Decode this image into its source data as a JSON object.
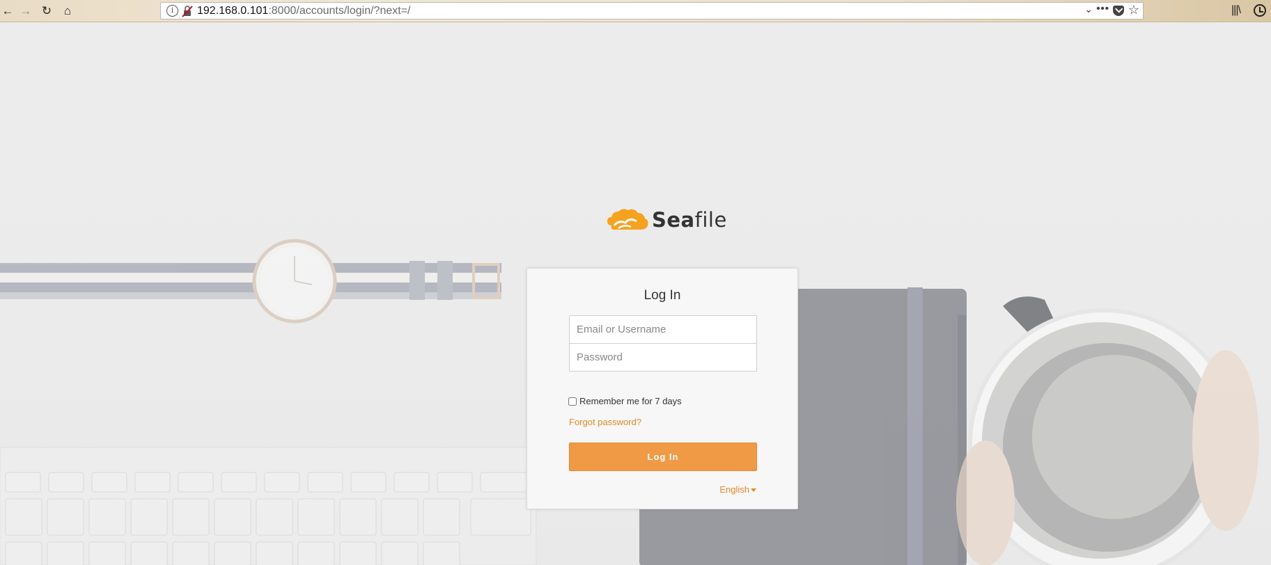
{
  "browser": {
    "url_host": "192.168.0.101",
    "url_rest": ":8000/accounts/login/?next=/"
  },
  "logo": {
    "text_bold": "Sea",
    "text_rest": "file",
    "accent": "#f5a623"
  },
  "login": {
    "title": "Log In",
    "username_placeholder": "Email or Username",
    "password_placeholder": "Password",
    "remember_label": "Remember me for 7 days",
    "forgot_label": "Forgot password?",
    "submit_label": "Log In",
    "language": "English"
  },
  "colors": {
    "button": "#f09a46",
    "link": "#e88a25"
  }
}
